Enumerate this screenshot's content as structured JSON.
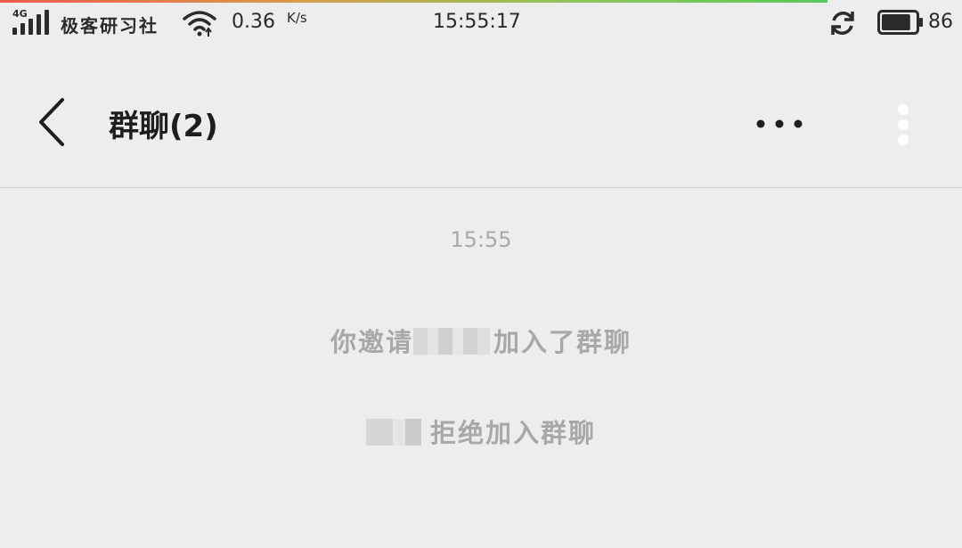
{
  "status_bar": {
    "network_type": "4G",
    "carrier": "极客研习社",
    "net_speed": "0.36",
    "net_speed_unit": "K/s",
    "time": "15:55:17",
    "battery_level": "86",
    "progress_fraction": 0.86
  },
  "header": {
    "title": "群聊(2)"
  },
  "chat": {
    "timestamp": "15:55",
    "messages": [
      {
        "prefix": "你邀请",
        "suffix": "加入了群聊"
      },
      {
        "prefix": "",
        "suffix": "拒绝加入群聊"
      }
    ]
  },
  "icons": {
    "back": "chevron-left-icon",
    "more": "more-horizontal-icon",
    "overflow": "more-vertical-icon",
    "sync": "sync-icon",
    "wifi": "wifi-icon",
    "battery": "battery-icon",
    "signal": "signal-icon"
  },
  "colors": {
    "background": "#ededed",
    "title_text": "#1e1e1e",
    "system_text": "#a8a8a8",
    "status_text": "#2b2b2b"
  }
}
